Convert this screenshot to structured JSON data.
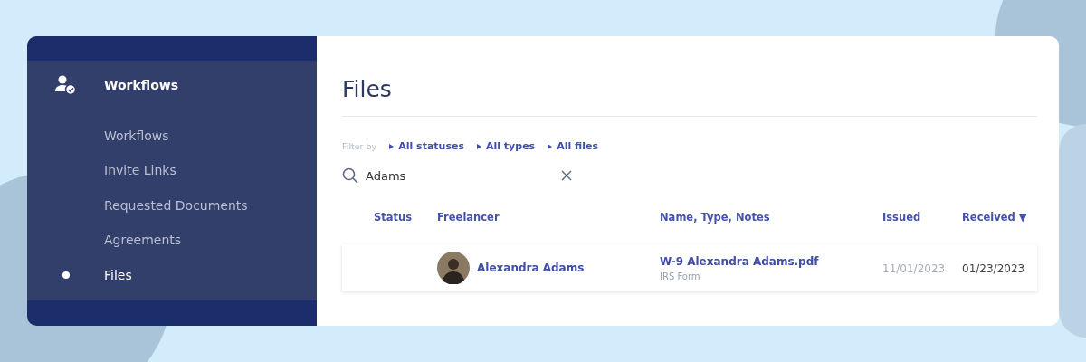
{
  "sidebar": {
    "section": {
      "label": "Workflows"
    },
    "items": [
      {
        "label": "Workflows",
        "selected": false
      },
      {
        "label": "Invite Links",
        "selected": false
      },
      {
        "label": "Requested Documents",
        "selected": false
      },
      {
        "label": "Agreements",
        "selected": false
      },
      {
        "label": "Files",
        "selected": true
      }
    ]
  },
  "main": {
    "title": "Files",
    "filter": {
      "label": "Filter by",
      "options": [
        "All statuses",
        "All types",
        "All files"
      ]
    },
    "search": {
      "value": "Adams"
    },
    "table": {
      "columns": [
        {
          "label": "Status"
        },
        {
          "label": "Freelancer"
        },
        {
          "label": "Name, Type, Notes"
        },
        {
          "label": "Issued"
        },
        {
          "label": "Received",
          "sort": "▼"
        }
      ],
      "rows": [
        {
          "freelancer": "Alexandra Adams",
          "file_name": "W-9 Alexandra Adams.pdf",
          "file_type": "IRS Form",
          "issued": "11/01/2023",
          "received": "01/23/2023"
        }
      ]
    }
  }
}
